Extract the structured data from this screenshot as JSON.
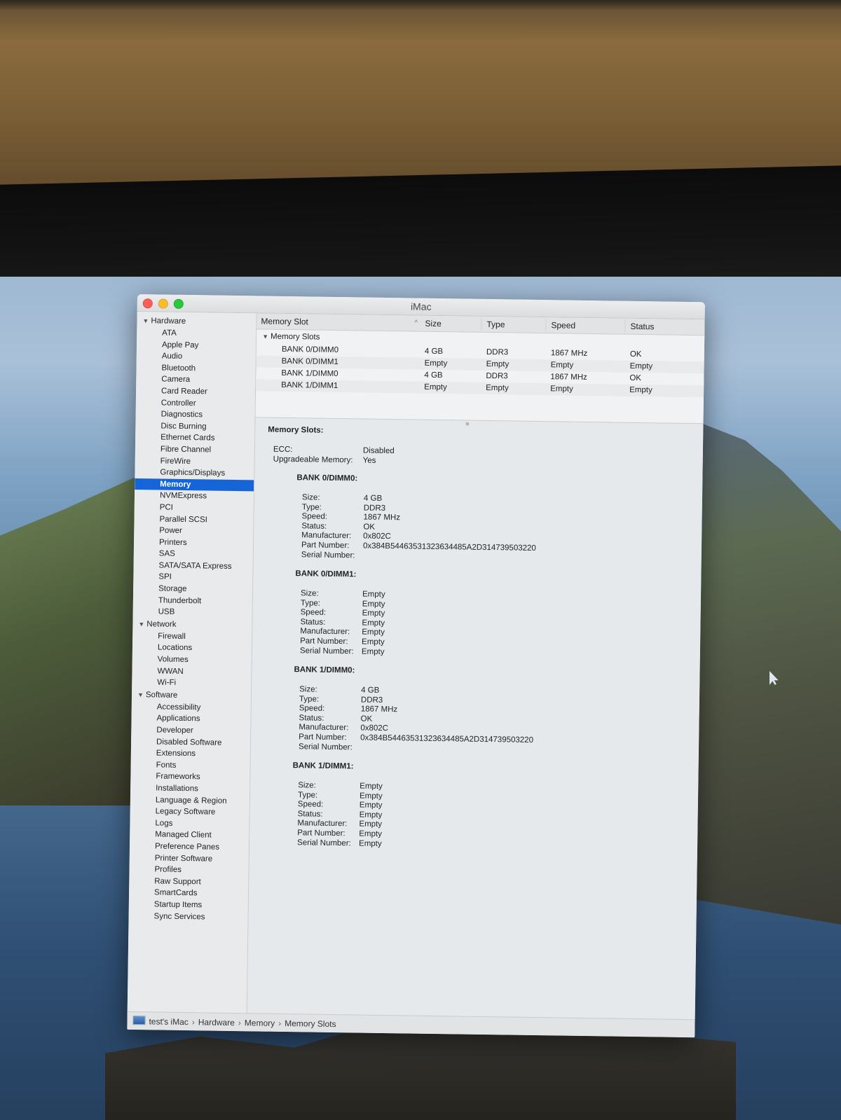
{
  "window": {
    "title": "iMac"
  },
  "sidebar": {
    "groups": [
      {
        "label": "Hardware",
        "items": [
          "ATA",
          "Apple Pay",
          "Audio",
          "Bluetooth",
          "Camera",
          "Card Reader",
          "Controller",
          "Diagnostics",
          "Disc Burning",
          "Ethernet Cards",
          "Fibre Channel",
          "FireWire",
          "Graphics/Displays",
          "Memory",
          "NVMExpress",
          "PCI",
          "Parallel SCSI",
          "Power",
          "Printers",
          "SAS",
          "SATA/SATA Express",
          "SPI",
          "Storage",
          "Thunderbolt",
          "USB"
        ]
      },
      {
        "label": "Network",
        "items": [
          "Firewall",
          "Locations",
          "Volumes",
          "WWAN",
          "Wi-Fi"
        ]
      },
      {
        "label": "Software",
        "items": [
          "Accessibility",
          "Applications",
          "Developer",
          "Disabled Software",
          "Extensions",
          "Fonts",
          "Frameworks",
          "Installations",
          "Language & Region",
          "Legacy Software",
          "Logs",
          "Managed Client",
          "Preference Panes",
          "Printer Software",
          "Profiles",
          "Raw Support",
          "SmartCards",
          "Startup Items",
          "Sync Services"
        ]
      }
    ],
    "selected": "Memory"
  },
  "table": {
    "headers": {
      "slot": "Memory Slot",
      "size": "Size",
      "type": "Type",
      "speed": "Speed",
      "status": "Status"
    },
    "sort_indicator": "^",
    "group": "Memory Slots",
    "rows": [
      {
        "slot": "BANK 0/DIMM0",
        "size": "4 GB",
        "type": "DDR3",
        "speed": "1867 MHz",
        "status": "OK"
      },
      {
        "slot": "BANK 0/DIMM1",
        "size": "Empty",
        "type": "Empty",
        "speed": "Empty",
        "status": "Empty"
      },
      {
        "slot": "BANK 1/DIMM0",
        "size": "4 GB",
        "type": "DDR3",
        "speed": "1867 MHz",
        "status": "OK"
      },
      {
        "slot": "BANK 1/DIMM1",
        "size": "Empty",
        "type": "Empty",
        "speed": "Empty",
        "status": "Empty"
      }
    ]
  },
  "detail": {
    "heading": "Memory Slots:",
    "ecc_label": "ECC:",
    "ecc_value": "Disabled",
    "upgradeable_label": "Upgradeable Memory:",
    "upgradeable_value": "Yes",
    "labels": {
      "size": "Size:",
      "type": "Type:",
      "speed": "Speed:",
      "status": "Status:",
      "manufacturer": "Manufacturer:",
      "part": "Part Number:",
      "serial": "Serial Number:"
    },
    "banks": [
      {
        "title": "BANK 0/DIMM0:",
        "size": "4 GB",
        "type": "DDR3",
        "speed": "1867 MHz",
        "status": "OK",
        "manufacturer": "0x802C",
        "part": "0x384B54463531323634485A2D314739503220",
        "serial": ""
      },
      {
        "title": "BANK 0/DIMM1:",
        "size": "Empty",
        "type": "Empty",
        "speed": "Empty",
        "status": "Empty",
        "manufacturer": "Empty",
        "part": "Empty",
        "serial": "Empty"
      },
      {
        "title": "BANK 1/DIMM0:",
        "size": "4 GB",
        "type": "DDR3",
        "speed": "1867 MHz",
        "status": "OK",
        "manufacturer": "0x802C",
        "part": "0x384B54463531323634485A2D314739503220",
        "serial": ""
      },
      {
        "title": "BANK 1/DIMM1:",
        "size": "Empty",
        "type": "Empty",
        "speed": "Empty",
        "status": "Empty",
        "manufacturer": "Empty",
        "part": "Empty",
        "serial": "Empty"
      }
    ]
  },
  "statusbar": {
    "crumbs": [
      "test's iMac",
      "Hardware",
      "Memory",
      "Memory Slots"
    ]
  },
  "colors": {
    "selection": "#1565d8",
    "close": "#fc5f57",
    "minimize": "#fdbc2e",
    "maximize": "#28c840"
  }
}
